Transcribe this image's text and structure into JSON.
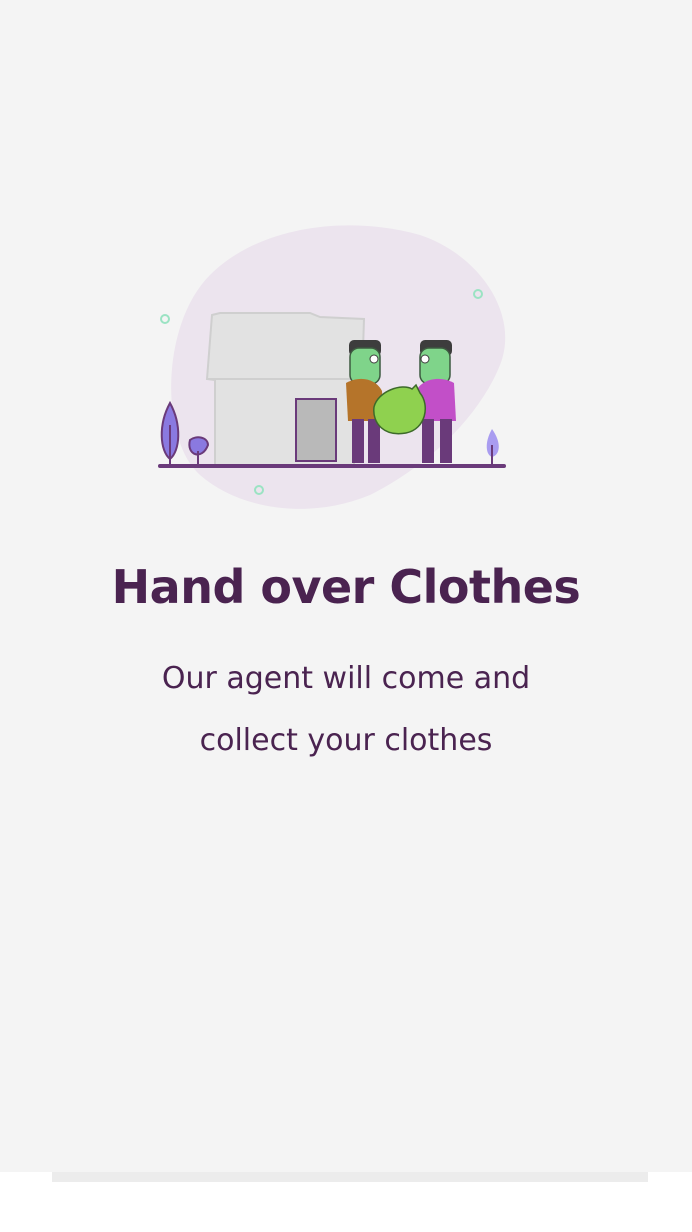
{
  "onboarding": {
    "title": "Hand over Clothes",
    "subtitle_line1": "Our agent will come and",
    "subtitle_line2": "collect your clothes",
    "illustration_icon": "two-people-handing-over-clothes-bag-icon"
  },
  "colors": {
    "background": "#f4f4f4",
    "text": "#4a2350",
    "accent_purple": "#6a3a7a",
    "bag_green": "#8fd14f",
    "skin_green": "#7fd48a",
    "blob": "#ece4ee"
  }
}
